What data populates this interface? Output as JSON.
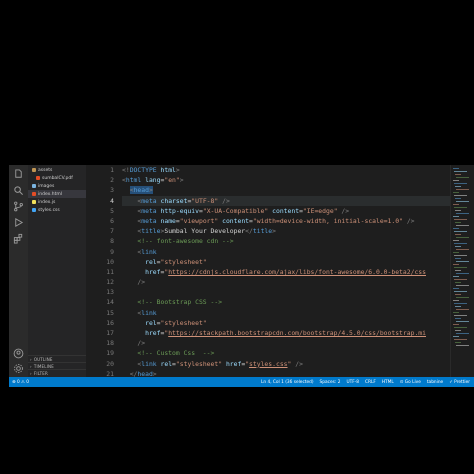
{
  "explorer": {
    "items": [
      {
        "label": "assets",
        "color": "#c09553"
      },
      {
        "label": "sumbalCV.pdf",
        "color": "#e44d26"
      },
      {
        "label": "images",
        "color": "#7ab4e0"
      },
      {
        "label": "index.html",
        "color": "#e44d26"
      },
      {
        "label": "index.js",
        "color": "#f1e05a"
      },
      {
        "label": "styles.css",
        "color": "#42a5f5"
      }
    ],
    "panels": [
      "OUTLINE",
      "TIMELINE",
      "FILTER"
    ]
  },
  "editor": {
    "active_line": 4,
    "lines": [
      {
        "n": "1",
        "tokens": [
          {
            "t": "tok-punc",
            "v": "<!"
          },
          {
            "t": "tok-tag",
            "v": "DOCTYPE"
          },
          {
            "t": "tok-tx",
            "v": " "
          },
          {
            "t": "tok-attr",
            "v": "html"
          },
          {
            "t": "tok-punc",
            "v": ">"
          }
        ]
      },
      {
        "n": "2",
        "tokens": [
          {
            "t": "tok-punc",
            "v": "<"
          },
          {
            "t": "tok-tag",
            "v": "html"
          },
          {
            "t": "tok-tx",
            "v": " "
          },
          {
            "t": "tok-attr",
            "v": "lang"
          },
          {
            "t": "tok-tx",
            "v": "="
          },
          {
            "t": "tok-str",
            "v": "\"en\""
          },
          {
            "t": "tok-punc",
            "v": ">"
          }
        ]
      },
      {
        "n": "3",
        "tokens": [
          {
            "t": "tok-tx",
            "v": "  "
          },
          {
            "t": "tok-punc",
            "v": "<"
          },
          {
            "t": "tok-tag",
            "v": "head"
          },
          {
            "t": "tok-punc",
            "v": ">"
          }
        ]
      },
      {
        "n": "4",
        "tokens": [
          {
            "t": "tok-tx",
            "v": "    "
          },
          {
            "t": "tok-punc",
            "v": "<"
          },
          {
            "t": "tok-tag",
            "v": "meta"
          },
          {
            "t": "tok-tx",
            "v": " "
          },
          {
            "t": "tok-attr",
            "v": "charset"
          },
          {
            "t": "tok-tx",
            "v": "="
          },
          {
            "t": "tok-str",
            "v": "\"UTF-8\""
          },
          {
            "t": "tok-tx",
            "v": " "
          },
          {
            "t": "tok-punc",
            "v": "/>"
          }
        ]
      },
      {
        "n": "5",
        "tokens": [
          {
            "t": "tok-tx",
            "v": "    "
          },
          {
            "t": "tok-punc",
            "v": "<"
          },
          {
            "t": "tok-tag",
            "v": "meta"
          },
          {
            "t": "tok-tx",
            "v": " "
          },
          {
            "t": "tok-attr",
            "v": "http-equiv"
          },
          {
            "t": "tok-tx",
            "v": "="
          },
          {
            "t": "tok-str",
            "v": "\"X-UA-Compatible\""
          },
          {
            "t": "tok-tx",
            "v": " "
          },
          {
            "t": "tok-attr",
            "v": "content"
          },
          {
            "t": "tok-tx",
            "v": "="
          },
          {
            "t": "tok-str",
            "v": "\"IE=edge\""
          },
          {
            "t": "tok-tx",
            "v": " "
          },
          {
            "t": "tok-punc",
            "v": "/>"
          }
        ]
      },
      {
        "n": "6",
        "tokens": [
          {
            "t": "tok-tx",
            "v": "    "
          },
          {
            "t": "tok-punc",
            "v": "<"
          },
          {
            "t": "tok-tag",
            "v": "meta"
          },
          {
            "t": "tok-tx",
            "v": " "
          },
          {
            "t": "tok-attr",
            "v": "name"
          },
          {
            "t": "tok-tx",
            "v": "="
          },
          {
            "t": "tok-str",
            "v": "\"viewport\""
          },
          {
            "t": "tok-tx",
            "v": " "
          },
          {
            "t": "tok-attr",
            "v": "content"
          },
          {
            "t": "tok-tx",
            "v": "="
          },
          {
            "t": "tok-str",
            "v": "\"width=device-width, initial-scale=1.0\""
          },
          {
            "t": "tok-tx",
            "v": " "
          },
          {
            "t": "tok-punc",
            "v": "/>"
          }
        ]
      },
      {
        "n": "7",
        "tokens": [
          {
            "t": "tok-tx",
            "v": "    "
          },
          {
            "t": "tok-punc",
            "v": "<"
          },
          {
            "t": "tok-tag",
            "v": "title"
          },
          {
            "t": "tok-punc",
            "v": ">"
          },
          {
            "t": "tok-tx",
            "v": "Sumbal Your Developer"
          },
          {
            "t": "tok-punc",
            "v": "</"
          },
          {
            "t": "tok-tag",
            "v": "title"
          },
          {
            "t": "tok-punc",
            "v": ">"
          }
        ]
      },
      {
        "n": "8",
        "tokens": [
          {
            "t": "tok-tx",
            "v": "    "
          },
          {
            "t": "tok-cm",
            "v": "<!-- font-awesome cdn -->"
          }
        ]
      },
      {
        "n": "9",
        "tokens": [
          {
            "t": "tok-tx",
            "v": "    "
          },
          {
            "t": "tok-punc",
            "v": "<"
          },
          {
            "t": "tok-tag",
            "v": "link"
          }
        ]
      },
      {
        "n": "10",
        "tokens": [
          {
            "t": "tok-tx",
            "v": "      "
          },
          {
            "t": "tok-attr",
            "v": "rel"
          },
          {
            "t": "tok-tx",
            "v": "="
          },
          {
            "t": "tok-str",
            "v": "\"stylesheet\""
          }
        ]
      },
      {
        "n": "11",
        "tokens": [
          {
            "t": "tok-tx",
            "v": "      "
          },
          {
            "t": "tok-attr",
            "v": "href"
          },
          {
            "t": "tok-tx",
            "v": "="
          },
          {
            "t": "tok-str",
            "v": "\""
          },
          {
            "t": "tok-url",
            "v": "https://cdnjs.cloudflare.com/ajax/libs/font-awesome/6.0.0-beta2/css"
          }
        ]
      },
      {
        "n": "12",
        "tokens": [
          {
            "t": "tok-tx",
            "v": "    "
          },
          {
            "t": "tok-punc",
            "v": "/>"
          }
        ]
      },
      {
        "n": "13",
        "tokens": []
      },
      {
        "n": "14",
        "tokens": [
          {
            "t": "tok-tx",
            "v": "    "
          },
          {
            "t": "tok-cm",
            "v": "<!-- Bootstrap CSS -->"
          }
        ]
      },
      {
        "n": "15",
        "tokens": [
          {
            "t": "tok-tx",
            "v": "    "
          },
          {
            "t": "tok-punc",
            "v": "<"
          },
          {
            "t": "tok-tag",
            "v": "link"
          }
        ]
      },
      {
        "n": "16",
        "tokens": [
          {
            "t": "tok-tx",
            "v": "      "
          },
          {
            "t": "tok-attr",
            "v": "rel"
          },
          {
            "t": "tok-tx",
            "v": "="
          },
          {
            "t": "tok-str",
            "v": "\"stylesheet\""
          }
        ]
      },
      {
        "n": "17",
        "tokens": [
          {
            "t": "tok-tx",
            "v": "      "
          },
          {
            "t": "tok-attr",
            "v": "href"
          },
          {
            "t": "tok-tx",
            "v": "="
          },
          {
            "t": "tok-str",
            "v": "\""
          },
          {
            "t": "tok-url",
            "v": "https://stackpath.bootstrapcdn.com/bootstrap/4.5.0/css/bootstrap.mi"
          }
        ]
      },
      {
        "n": "18",
        "tokens": [
          {
            "t": "tok-tx",
            "v": "    "
          },
          {
            "t": "tok-punc",
            "v": "/>"
          }
        ]
      },
      {
        "n": "19",
        "tokens": [
          {
            "t": "tok-tx",
            "v": "    "
          },
          {
            "t": "tok-cm",
            "v": "<!-- Custom Css  -->"
          }
        ]
      },
      {
        "n": "20",
        "tokens": [
          {
            "t": "tok-tx",
            "v": "    "
          },
          {
            "t": "tok-punc",
            "v": "<"
          },
          {
            "t": "tok-tag",
            "v": "link"
          },
          {
            "t": "tok-tx",
            "v": " "
          },
          {
            "t": "tok-attr",
            "v": "rel"
          },
          {
            "t": "tok-tx",
            "v": "="
          },
          {
            "t": "tok-str",
            "v": "\"stylesheet\""
          },
          {
            "t": "tok-tx",
            "v": " "
          },
          {
            "t": "tok-attr",
            "v": "href"
          },
          {
            "t": "tok-tx",
            "v": "="
          },
          {
            "t": "tok-str",
            "v": "\""
          },
          {
            "t": "tok-url",
            "v": "styles.css"
          },
          {
            "t": "tok-str",
            "v": "\""
          },
          {
            "t": "tok-tx",
            "v": " "
          },
          {
            "t": "tok-punc",
            "v": "/>"
          }
        ]
      },
      {
        "n": "21",
        "tokens": [
          {
            "t": "tok-tx",
            "v": "  "
          },
          {
            "t": "tok-punc",
            "v": "</"
          },
          {
            "t": "tok-tag",
            "v": "head"
          },
          {
            "t": "tok-punc",
            "v": ">"
          }
        ]
      }
    ]
  },
  "statusbar": {
    "left": "⊗ 0 ⚠ 0",
    "items": [
      "Ln 4, Col 1 (36 selected)",
      "Spaces: 2",
      "UTF-8",
      "CRLF",
      "HTML",
      "⊙ Go Live",
      "tabnine",
      "✓ Prettier"
    ]
  },
  "colors": {
    "statusbar": "#007acc",
    "editor_bg": "#1e1e1e",
    "sidebar_bg": "#252526"
  },
  "icons": [
    "files-icon",
    "search-icon",
    "source-control-icon",
    "run-debug-icon",
    "extensions-icon",
    "account-icon",
    "settings-gear-icon"
  ]
}
